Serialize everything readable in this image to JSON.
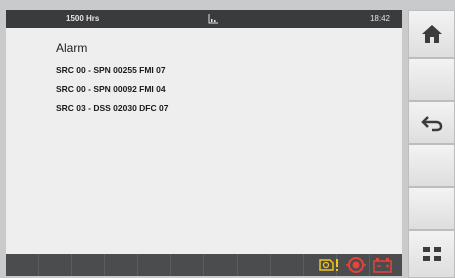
{
  "status_bar": {
    "hours": "1500 Hrs",
    "time": "18:42",
    "center_icon": "chart-icon"
  },
  "alarm": {
    "title": "Alarm",
    "items": [
      "SRC 00 - SPN 00255  FMI 07",
      "SRC 00 - SPN 00092  FMI 04",
      "SRC 03 - DSS 02030  DFC 07"
    ]
  },
  "status_icons": [
    {
      "name": "engine-warning-icon",
      "color": "#f0c419"
    },
    {
      "name": "stop-icon",
      "color": "#e8423a"
    },
    {
      "name": "battery-icon",
      "color": "#e8423a"
    }
  ],
  "side_buttons": [
    {
      "name": "home-icon"
    },
    {
      "name": "blank"
    },
    {
      "name": "back-icon"
    },
    {
      "name": "blank"
    },
    {
      "name": "blank"
    },
    {
      "name": "grid-menu-icon"
    }
  ],
  "colors": {
    "icon_dark": "#3c3c3c",
    "warning": "#f0c419",
    "alert": "#e8423a"
  }
}
